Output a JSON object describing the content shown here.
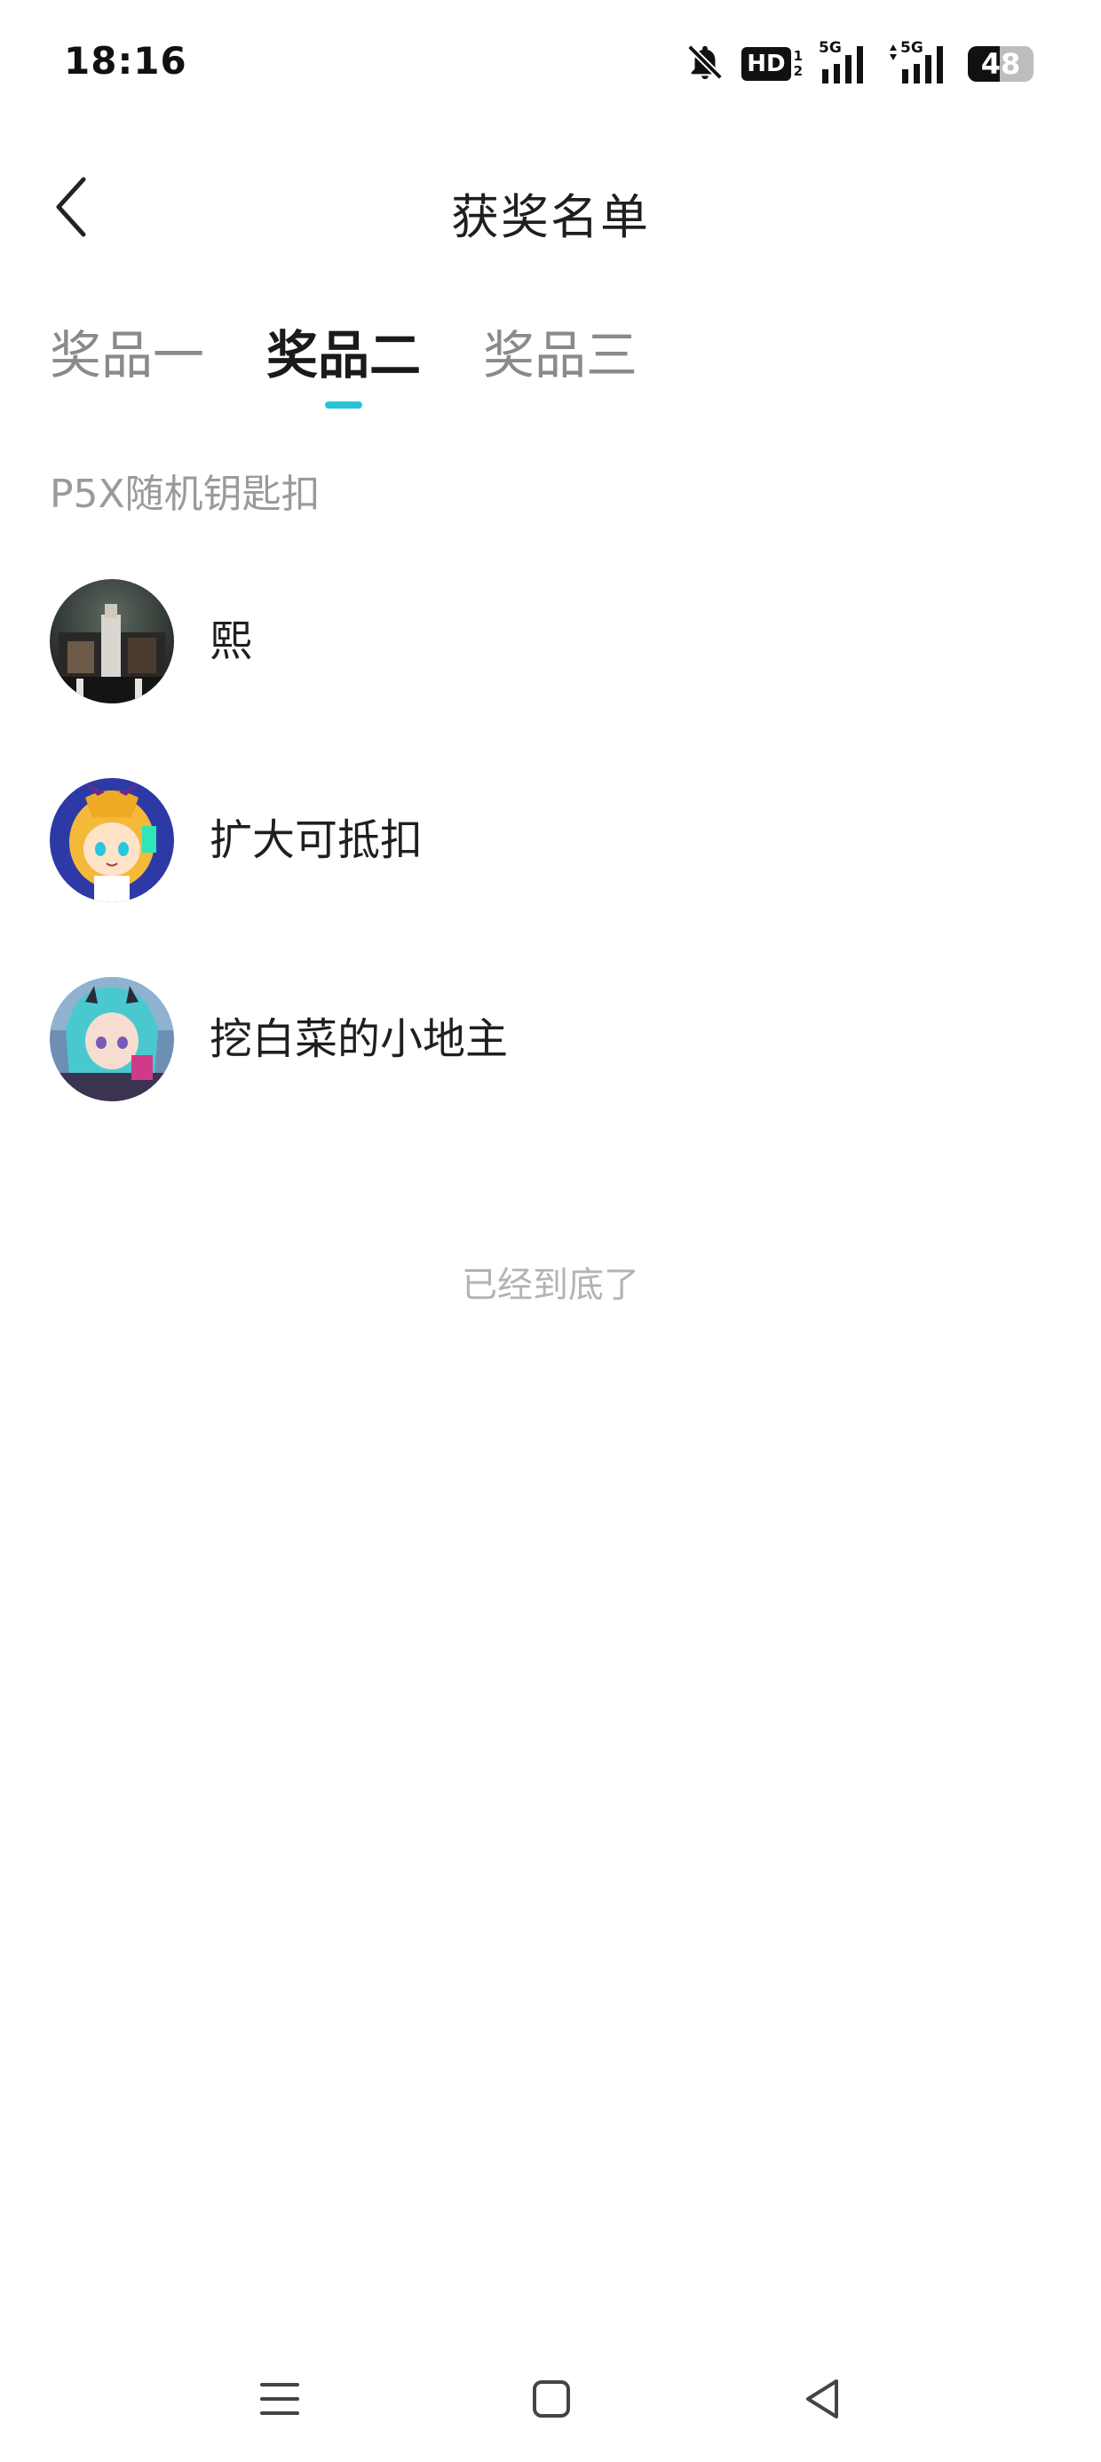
{
  "status_bar": {
    "time": "18:16",
    "hd_label": "HD",
    "hd_sub_top": "1",
    "hd_sub_bottom": "2",
    "signal1_label": "5G",
    "signal2_label": "5G",
    "battery_level": "48",
    "icons": [
      "bell-off-icon",
      "hd-voice-icon",
      "signal-5g-icon",
      "signal-5g-data-icon",
      "battery-icon"
    ]
  },
  "header": {
    "title": "获奖名单",
    "back_icon": "chevron-left-icon"
  },
  "tabs": [
    {
      "label": "奖品一",
      "active": false
    },
    {
      "label": "奖品二",
      "active": true
    },
    {
      "label": "奖品三",
      "active": false
    }
  ],
  "prize": {
    "name": "P5X随机钥匙扣"
  },
  "winners": [
    {
      "name": "熙",
      "avatar": "avatar-dark-photo"
    },
    {
      "name": "扩大可抵扣",
      "avatar": "avatar-blonde-anime-girl"
    },
    {
      "name": "挖白菜的小地主",
      "avatar": "avatar-cyan-hair-anime-girl"
    }
  ],
  "list_end_text": "已经到底了",
  "colors": {
    "accent": "#27c4d8",
    "title": "#1f1f1f",
    "inactive_tab": "#8a8a8a",
    "muted": "#9a9a9a",
    "end_text": "#b3b3b3"
  },
  "system_nav": {
    "icons": [
      "menu-icon",
      "home-square-icon",
      "back-triangle-icon"
    ]
  }
}
